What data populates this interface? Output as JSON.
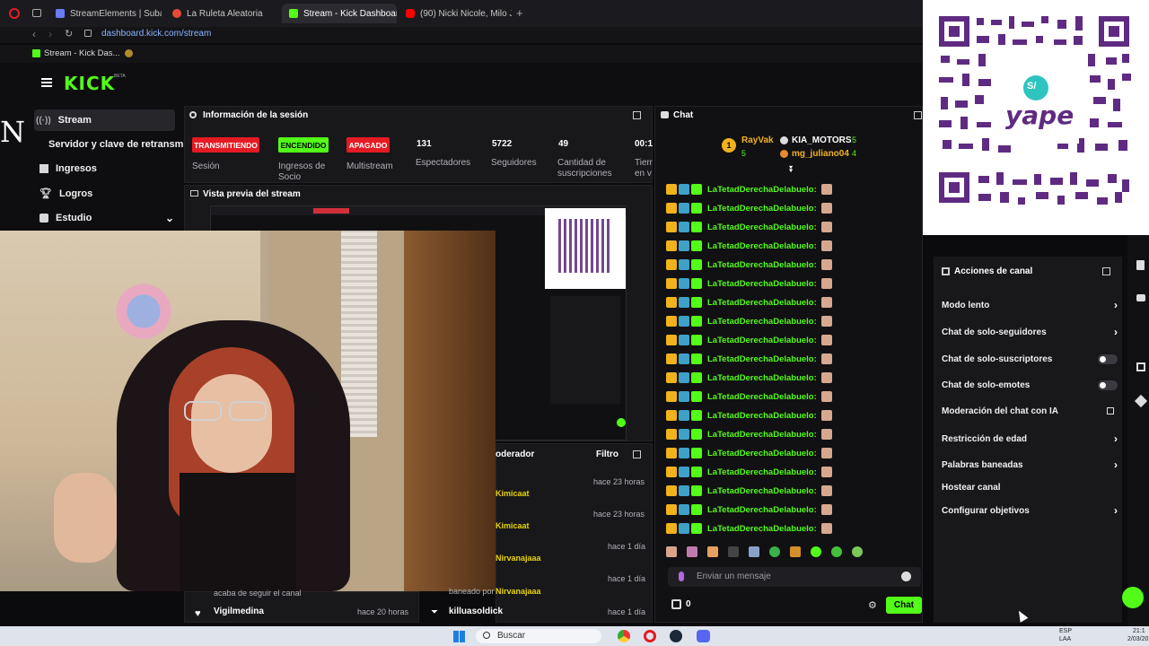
{
  "browser": {
    "tabs": [
      {
        "label": "StreamElements | Subatho",
        "color": "#6b7cff"
      },
      {
        "label": "La Ruleta Aleatoria",
        "color": "#e64a3a"
      },
      {
        "label": "Stream - Kick Dashboard",
        "color": "#53fc18"
      },
      {
        "label": "(90) Nicki Nicole, Milo J -",
        "color": "#ff0000"
      }
    ],
    "new_tab": "+",
    "url": "dashboard.kick.com/stream",
    "bookmark": "Stream - Kick Das..."
  },
  "kick": {
    "logo": "KICK",
    "logo_tag": "BETA",
    "side_letter": "N",
    "sidebar": [
      {
        "label": "Stream",
        "icon": "broadcast-icon"
      },
      {
        "label": "Servidor y clave de retransm"
      },
      {
        "label": "Ingresos",
        "icon": "chart-icon"
      },
      {
        "label": "Logros",
        "icon": "trophy-icon"
      },
      {
        "label": "Estudio",
        "icon": "studio-icon",
        "chevron": "⌄"
      }
    ]
  },
  "session": {
    "title": "Información de la sesión",
    "badges": [
      {
        "label": "TRANSMITIENDO",
        "sub": "Sesión",
        "color": "#e51b23"
      },
      {
        "label": "ENCENDIDO",
        "sub": "Ingresos de Socio",
        "color": "#53fc18"
      },
      {
        "label": "APAGADO",
        "sub": "Multistream",
        "color": "#e51b23"
      }
    ],
    "stats": [
      {
        "value": "131",
        "label": "Espectadores"
      },
      {
        "value": "5722",
        "label": "Seguidores"
      },
      {
        "value": "49",
        "label": "Cantidad de suscripciones"
      },
      {
        "value": "00:1",
        "label": "Tiem en v"
      }
    ]
  },
  "preview": {
    "title": "Vista previa del stream"
  },
  "activity": {
    "header_left": "oderador",
    "filter": "Filtro",
    "rows": [
      {
        "user": "Kimicaat",
        "time": "hace 23 horas"
      },
      {
        "user": "Kimicaat",
        "time": "hace 23 horas"
      },
      {
        "user": "Nirvanajaaa",
        "time": "hace 1 día"
      },
      {
        "user": "Nirvanajaaa",
        "time": "hace 1 día",
        "note": "baneado por"
      },
      {
        "user": "killuasoldick",
        "time": "hace 1 día"
      }
    ],
    "left_note": "acaba de seguir el canal",
    "left_user": "Vigilmedina",
    "left_time": "hace 20 horas"
  },
  "chat": {
    "title": "Chat",
    "top": [
      {
        "rank": "1",
        "name": "RayVak",
        "count": "5"
      },
      {
        "name": "KIA_MOTORS",
        "count": "5"
      },
      {
        "name": "mg_juliano04",
        "count": "4"
      }
    ],
    "message_user": "LaTetadDerechaDelabuelo:",
    "message_count": 19,
    "input_placeholder": "Enviar un mensaje",
    "viewer_count": "0",
    "send_label": "Chat"
  },
  "actions": {
    "title": "Acciones de canal",
    "items": [
      {
        "label": "Modo lento",
        "kind": "chevron"
      },
      {
        "label": "Chat de solo-seguidores",
        "kind": "chevron"
      },
      {
        "label": "Chat de solo-suscriptores",
        "kind": "toggle"
      },
      {
        "label": "Chat de solo-emotes",
        "kind": "toggle"
      },
      {
        "label": "Moderación del chat con IA",
        "kind": "external"
      },
      {
        "label": "Restricción de edad",
        "kind": "chevron"
      },
      {
        "label": "Palabras baneadas",
        "kind": "chevron"
      },
      {
        "label": "Hostear canal",
        "kind": "none"
      },
      {
        "label": "Configurar objetivos",
        "kind": "chevron"
      }
    ]
  },
  "qr": {
    "brand": "yape",
    "symbol": "S/"
  },
  "taskbar": {
    "search": "Buscar",
    "lang": "ESP",
    "lang2": "LAA",
    "time": "21:1",
    "date": "2/03/20"
  }
}
